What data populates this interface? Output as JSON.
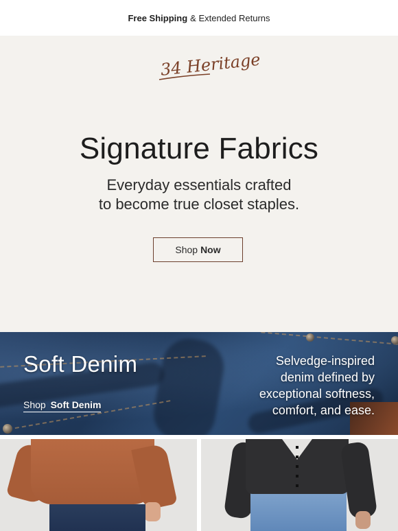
{
  "topbar": {
    "shipping_bold": "Free Shipping",
    "shipping_rest": "& Extended Returns"
  },
  "brand": {
    "logo_text": "34 Heritage",
    "logo_color": "#7a3f26"
  },
  "hero": {
    "title": "Signature Fabrics",
    "subtitle_line1": "Everyday essentials crafted",
    "subtitle_line2": "to become true closet staples.",
    "button_label_regular": "Shop",
    "button_label_bold": "Now",
    "background": "#f4f2ee"
  },
  "denim": {
    "title": "Soft Denim",
    "link_regular": "Shop",
    "link_bold": "Soft Denim",
    "desc_line1": "Selvedge-inspired",
    "desc_line2": "denim defined by",
    "desc_line3": "exceptional softness,",
    "desc_line4": "comfort, and ease."
  },
  "products": [
    {
      "item": "rust-sweater"
    },
    {
      "item": "charcoal-cardigan"
    }
  ]
}
